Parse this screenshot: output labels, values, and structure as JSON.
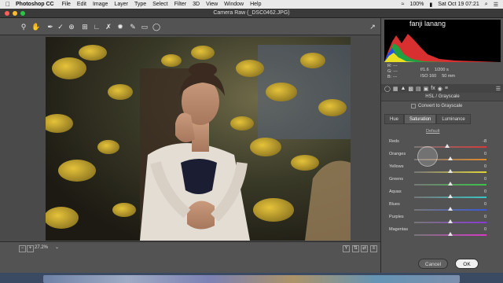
{
  "menubar": {
    "app_name": "Photoshop CC",
    "items": [
      "File",
      "Edit",
      "Image",
      "Layer",
      "Type",
      "Select",
      "Filter",
      "3D",
      "View",
      "Window",
      "Help"
    ],
    "battery": "100%",
    "clock": "Sat Oct 19  07:21"
  },
  "window": {
    "title": "Camera Raw (_DSC0462.JPG)"
  },
  "canvas": {
    "zoom": "27.2%"
  },
  "panel": {
    "user_name": "fanji lanang",
    "readout": {
      "r_label": "R:",
      "r_value": "---",
      "g_label": "G:",
      "g_value": "---",
      "b_label": "B:",
      "b_value": "---"
    },
    "camera_info": {
      "aperture": "f/1.6",
      "shutter": "1/200 s",
      "iso": "ISO 160",
      "focal": "50 mm"
    },
    "section_title": "HSL / Grayscale",
    "convert_label": "Convert to Grayscale",
    "tabs": [
      "Hue",
      "Saturation",
      "Luminance"
    ],
    "active_tab": "Saturation",
    "default_link": "Default",
    "sliders": [
      {
        "label": "Reds",
        "value": "-8",
        "fraction": 0.46
      },
      {
        "label": "Oranges",
        "value": "0",
        "fraction": 0.5
      },
      {
        "label": "Yellows",
        "value": "0",
        "fraction": 0.5
      },
      {
        "label": "Greens",
        "value": "0",
        "fraction": 0.5
      },
      {
        "label": "Aquas",
        "value": "0",
        "fraction": 0.5
      },
      {
        "label": "Blues",
        "value": "0",
        "fraction": 0.5
      },
      {
        "label": "Purples",
        "value": "0",
        "fraction": 0.5
      },
      {
        "label": "Magentas",
        "value": "0",
        "fraction": 0.5
      }
    ],
    "cancel_label": "Cancel",
    "ok_label": "OK"
  },
  "colors": {
    "panel_bg": "#535353",
    "slider_reds": "#d43a3a",
    "slider_oranges": "#e08a2c",
    "slider_yellows": "#e0d43a",
    "slider_greens": "#3ac44a",
    "slider_aquas": "#3ac4c4",
    "slider_blues": "#3a5ad4",
    "slider_purples": "#8a3ad4",
    "slider_magentas": "#d43ac4"
  }
}
